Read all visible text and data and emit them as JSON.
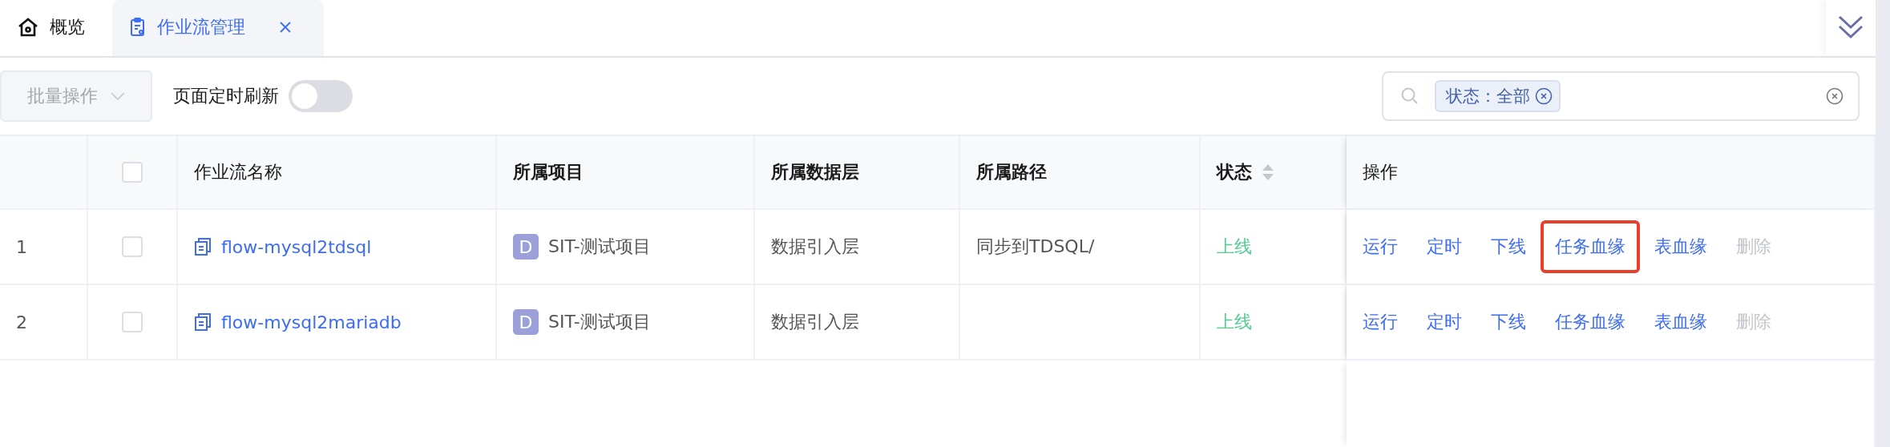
{
  "tabs": [
    {
      "label": "概览",
      "selected": false,
      "closable": false
    },
    {
      "label": "作业流管理",
      "selected": true,
      "closable": true
    }
  ],
  "toolbar": {
    "batch_button": {
      "label": "批量操作",
      "disabled": true
    },
    "auto_refresh": {
      "label": "页面定时刷新",
      "on": false
    }
  },
  "search": {
    "tags": [
      {
        "label": "状态：全部"
      }
    ]
  },
  "table": {
    "columns": [
      {
        "kind": "index"
      },
      {
        "kind": "checkbox",
        "checked": false
      },
      {
        "kind": "text",
        "label": "作业流名称",
        "bold": false
      },
      {
        "kind": "text",
        "label": "所属项目",
        "bold": true
      },
      {
        "kind": "text",
        "label": "所属数据层",
        "bold": true
      },
      {
        "kind": "text",
        "label": "所属路径",
        "bold": true
      },
      {
        "kind": "sort",
        "label": "状态",
        "bold": true
      },
      {
        "kind": "text",
        "label": "操作",
        "bold": false
      }
    ],
    "rows": [
      {
        "index": "1",
        "checked": false,
        "name": "flow-mysql2tdsql",
        "project_badge": "D",
        "project": "SIT-测试项目",
        "layer": "数据引入层",
        "path": "同步到TDSQL/",
        "status": "上线",
        "online": true,
        "actions": [
          {
            "label": "运行",
            "disabled": false,
            "highlighted": false
          },
          {
            "label": "定时",
            "disabled": false,
            "highlighted": false
          },
          {
            "label": "下线",
            "disabled": false,
            "highlighted": false
          },
          {
            "label": "任务血缘",
            "disabled": false,
            "highlighted": true
          },
          {
            "label": "表血缘",
            "disabled": false,
            "highlighted": false
          },
          {
            "label": "删除",
            "disabled": true,
            "highlighted": false
          }
        ]
      },
      {
        "index": "2",
        "checked": false,
        "name": "flow-mysql2mariadb",
        "project_badge": "D",
        "project": "SIT-测试项目",
        "layer": "数据引入层",
        "status": "上线",
        "online": true,
        "actions": [
          {
            "label": "运行",
            "disabled": false,
            "highlighted": false
          },
          {
            "label": "定时",
            "disabled": false,
            "highlighted": false
          },
          {
            "label": "下线",
            "disabled": false,
            "highlighted": false
          },
          {
            "label": "任务血缘",
            "disabled": false,
            "highlighted": false
          },
          {
            "label": "表血缘",
            "disabled": false,
            "highlighted": false
          },
          {
            "label": "删除",
            "disabled": true,
            "highlighted": false
          }
        ]
      }
    ]
  }
}
